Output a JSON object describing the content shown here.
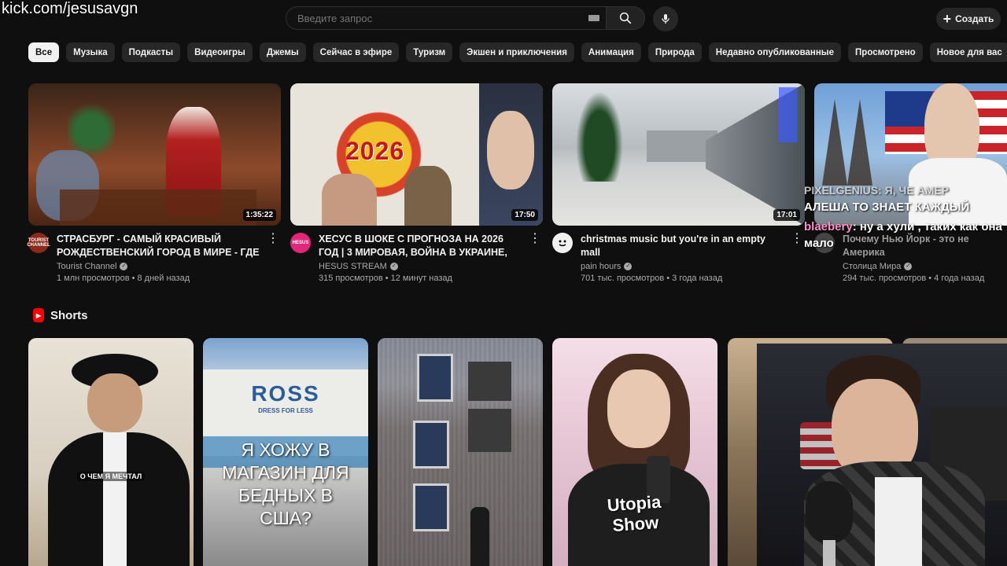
{
  "overlay": {
    "url": "kick.com/jesusavgn"
  },
  "header": {
    "search_placeholder": "Введите запрос",
    "create_label": "Создать"
  },
  "chips": [
    "Все",
    "Музыка",
    "Подкасты",
    "Видеоигры",
    "Джемы",
    "Сейчас в эфире",
    "Туризм",
    "Экшен и приключения",
    "Анимация",
    "Природа",
    "Недавно опубликованные",
    "Просмотрено",
    "Новое для вас"
  ],
  "videos": [
    {
      "title": "СТРАСБУРГ - САМЫЙ КРАСИВЫЙ РОЖДЕСТВЕНСКИЙ ГОРОД В МИРЕ - ГДЕ ...",
      "channel": "Tourist Channel",
      "stats": "1 млн просмотров • 8 дней назад",
      "duration": "1:35:22",
      "avatar_text": "TOURIST CHANNEL"
    },
    {
      "title": "ХЕСУС В ШОКЕ С ПРОГНОЗА НА 2026 ГОД | 3 МИРОВАЯ, ВОЙНА В УКРАИНЕ, КРАХ ...",
      "channel": "HESUS STREAM",
      "stats": "315 просмотров • 12 минут назад",
      "duration": "17:50",
      "avatar_text": "HESUS",
      "thumb_text": "2026"
    },
    {
      "title": "christmas music but you're in an empty mall",
      "channel": "pain hours",
      "stats": "701 тыс. просмотров • 3 года назад",
      "duration": "17:01",
      "avatar_text": ""
    },
    {
      "title": "Почему Нью Йорк - это не Америка",
      "channel": "Столица Мира",
      "stats": "294 тыс. просмотров • 4 года назад",
      "duration": "",
      "avatar_text": ""
    }
  ],
  "shorts": {
    "label": "Shorts",
    "items": [
      {
        "sticker": "О ЧЕМ Я МЕЧТАЛ"
      },
      {
        "sign": "ROSS",
        "sign_sub": "DRESS FOR LESS",
        "sticker": "Я ХОЖУ В МАГАЗИН ДЛЯ БЕДНЫХ В США?"
      },
      {
        "sticker": ""
      },
      {
        "sticker": "Utopia Show"
      },
      {
        "sticker": ""
      }
    ]
  },
  "chat_overlay": {
    "ghost": "PIXELGENIUS: Я, ЧЕ АМЕР",
    "line1": "АЛЕША ТО ЗНАЕТ КАЖДЫЙ",
    "user": "blaebery",
    "message": ": ну а хули , таких как она мало"
  }
}
